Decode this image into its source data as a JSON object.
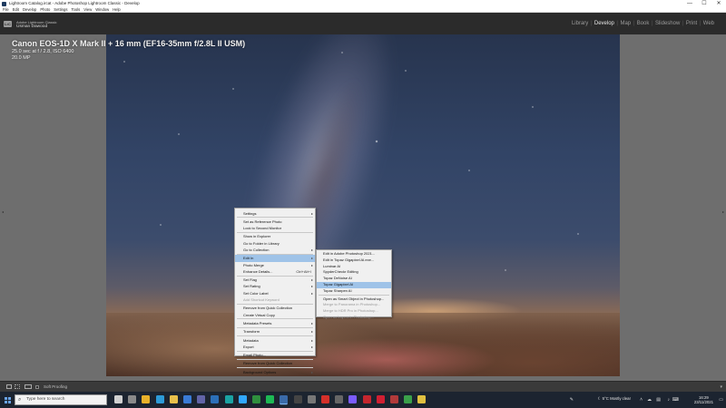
{
  "window": {
    "title": "Lightroom Catalog.ircat - Adobe Photoshop Lightroom Classic - Develop",
    "controls": {
      "minimize": "—",
      "maximize": "☐",
      "close": "✕"
    }
  },
  "menubar": {
    "items": [
      "File",
      "Edit",
      "Develop",
      "Photo",
      "Settings",
      "Tools",
      "View",
      "Window",
      "Help"
    ]
  },
  "identity": {
    "logo": "LrC",
    "line1": "Adobe Lightroom Classic",
    "name": "Usman Dawood"
  },
  "modules": {
    "items": [
      "Library",
      "Develop",
      "Map",
      "Book",
      "Slideshow",
      "Print",
      "Web"
    ],
    "active": "Develop",
    "separator": "|"
  },
  "photo_info": {
    "line1": "Canon EOS-1D X Mark II + 16 mm (EF16-35mm f/2.8L II USM)",
    "line2": "25.0 sec at f / 2.8, ISO 6400",
    "line3": "20.0 MP"
  },
  "context_menu": {
    "items": [
      {
        "label": "Settings",
        "arrow": "▸"
      },
      {
        "sep": true
      },
      {
        "label": "Set as Reference Photo"
      },
      {
        "label": "Lock to Second Monitor"
      },
      {
        "sep": true
      },
      {
        "label": "Show in Explorer"
      },
      {
        "label": "Go to Folder in Library"
      },
      {
        "label": "Go to Collection",
        "arrow": "▸"
      },
      {
        "sep": true
      },
      {
        "label": "Edit In",
        "arrow": "▸",
        "highlight": true
      },
      {
        "label": "Photo Merge",
        "arrow": "▸"
      },
      {
        "label": "Enhance Details...",
        "shortcut": "Ctrl+Alt+I"
      },
      {
        "sep": true
      },
      {
        "label": "Set Flag",
        "arrow": "▸"
      },
      {
        "label": "Set Rating",
        "arrow": "▸"
      },
      {
        "label": "Set Color Label",
        "arrow": "▸"
      },
      {
        "label": "Add Shortcut Keyword",
        "disabled": true
      },
      {
        "sep": true
      },
      {
        "label": "Remove from Quick Collection"
      },
      {
        "label": "Create Virtual Copy"
      },
      {
        "sep": true
      },
      {
        "label": "Metadata Presets",
        "arrow": "▸"
      },
      {
        "sep": true
      },
      {
        "label": "Transform",
        "arrow": "▸"
      },
      {
        "sep": true
      },
      {
        "label": "Metadata",
        "arrow": "▸"
      },
      {
        "label": "Export",
        "arrow": "▸"
      },
      {
        "sep": true
      },
      {
        "label": "Email Photo..."
      },
      {
        "sep": true
      },
      {
        "label": "Remove from Quick Collection"
      },
      {
        "sep": true
      },
      {
        "label": "Background Options",
        "arrow": "▸"
      }
    ]
  },
  "edit_in_submenu": {
    "items": [
      {
        "label": "Edit in Adobe Photoshop 2021..."
      },
      {
        "label": "Edit in Topaz Gigapixel AI.exe..."
      },
      {
        "label": "Luminar AI"
      },
      {
        "label": "SpyderCheckr Editing"
      },
      {
        "label": "Topaz DeNoise AI"
      },
      {
        "label": "Topaz Gigapixel AI",
        "highlight": true
      },
      {
        "label": "Topaz Sharpen AI"
      },
      {
        "sep": true
      },
      {
        "label": "Open as Smart Object in Photoshop..."
      },
      {
        "label": "Merge to Panorama in Photoshop...",
        "disabled": true
      },
      {
        "label": "Merge to HDR Pro in Photoshop...",
        "disabled": true
      },
      {
        "label": "Open as Layers in Photoshop...",
        "disabled": true
      }
    ]
  },
  "toolbar": {
    "soft_proofing": "Soft Proofing"
  },
  "taskbar": {
    "search_placeholder": "Type here to search",
    "apps": [
      {
        "name": "task-view",
        "color": "#d0d0d0"
      },
      {
        "name": "widgets",
        "color": "#8a8a8a"
      },
      {
        "name": "chrome",
        "color": "#e8b12a"
      },
      {
        "name": "edge",
        "color": "#2d9bd8"
      },
      {
        "name": "file-explorer",
        "color": "#e8c04a"
      },
      {
        "name": "mail",
        "color": "#3a7bd5"
      },
      {
        "name": "teams",
        "color": "#6264a7"
      },
      {
        "name": "app-blue",
        "color": "#2b6fb8"
      },
      {
        "name": "app-teal",
        "color": "#1aa3a3"
      },
      {
        "name": "photoshop",
        "color": "#31a8ff"
      },
      {
        "name": "app-green",
        "color": "#2f8f3e"
      },
      {
        "name": "spotify",
        "color": "#1db954"
      },
      {
        "name": "lightroom-classic",
        "color": "#3a6aa8",
        "active": true
      },
      {
        "name": "app-dark",
        "color": "#444"
      },
      {
        "name": "app-gray",
        "color": "#777"
      },
      {
        "name": "acrobat",
        "color": "#d4302a"
      },
      {
        "name": "app-mono",
        "color": "#666"
      },
      {
        "name": "premiere",
        "color": "#7b5cff"
      },
      {
        "name": "app-red",
        "color": "#c4262e"
      },
      {
        "name": "opera",
        "color": "#d01f32"
      },
      {
        "name": "app-red2",
        "color": "#b03a3a"
      },
      {
        "name": "app-green2",
        "color": "#3aa04a"
      },
      {
        "name": "app-yellow",
        "color": "#e0c040"
      }
    ],
    "weather": "5°C Mostly clear",
    "time": "16:29",
    "date": "23/11/2021"
  },
  "colors": {
    "highlight": "#9fc3e8",
    "canvas": "#6e6e6e",
    "topbar": "#2b2b2b"
  }
}
